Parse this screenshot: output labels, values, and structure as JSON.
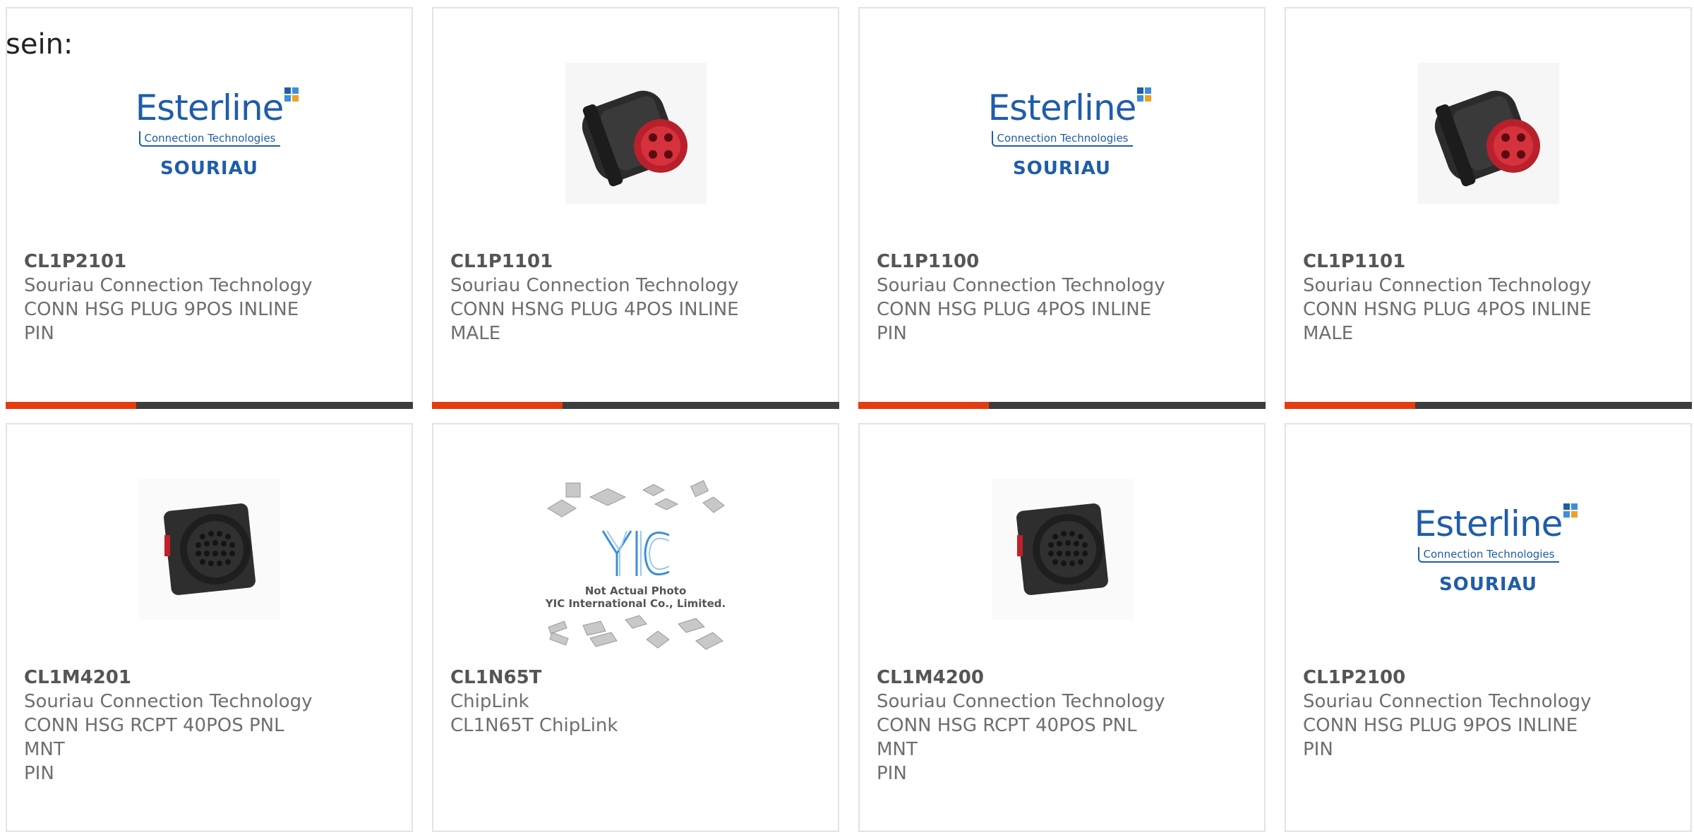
{
  "intro": {
    "text": "sein:"
  },
  "colors": {
    "accent_bar": "#e33c0f",
    "dark_bar": "#3d3d3d",
    "logo_blue": "#1f5da8",
    "connector_red": "#c0202a"
  },
  "cards": [
    {
      "part": "CL1P2101",
      "maker": "Souriau Connection Technology",
      "desc1": "CONN HSG PLUG 9POS INLINE",
      "desc2": "PIN",
      "image": "esterline-logo",
      "logo": {
        "brand": "Esterline",
        "sub": "Connection Technologies",
        "name": "SOURIAU"
      }
    },
    {
      "part": "CL1P1101",
      "maker": "Souriau Connection Technology",
      "desc1": "CONN HSNG PLUG 4POS INLINE",
      "desc2": "MALE",
      "image": "plug-connector-photo"
    },
    {
      "part": "CL1P1100",
      "maker": "Souriau Connection Technology",
      "desc1": "CONN HSG PLUG 4POS INLINE",
      "desc2": "PIN",
      "image": "esterline-logo",
      "logo": {
        "brand": "Esterline",
        "sub": "Connection Technologies",
        "name": "SOURIAU"
      }
    },
    {
      "part": "CL1P1101",
      "maker": "Souriau Connection Technology",
      "desc1": "CONN HSNG PLUG 4POS INLINE",
      "desc2": "MALE",
      "image": "plug-connector-photo"
    },
    {
      "part": "CL1M4201",
      "maker": "Souriau Connection Technology",
      "desc1": "CONN HSG RCPT 40POS PNL MNT",
      "desc2": "PIN",
      "image": "receptacle-connector-photo"
    },
    {
      "part": "CL1N65T",
      "maker": "ChipLink",
      "desc1": "CL1N65T ChipLink",
      "desc2": "",
      "image": "yic-placeholder",
      "placeholder": {
        "brand": "YIC",
        "line1": "Not Actual Photo",
        "line2": "YIC International Co., Limited."
      }
    },
    {
      "part": "CL1M4200",
      "maker": "Souriau Connection Technology",
      "desc1": "CONN HSG RCPT 40POS PNL MNT",
      "desc2": "PIN",
      "image": "receptacle-connector-photo"
    },
    {
      "part": "CL1P2100",
      "maker": "Souriau Connection Technology",
      "desc1": "CONN HSG PLUG 9POS INLINE",
      "desc2": "PIN",
      "image": "esterline-logo",
      "logo": {
        "brand": "Esterline",
        "sub": "Connection Technologies",
        "name": "SOURIAU"
      }
    }
  ]
}
